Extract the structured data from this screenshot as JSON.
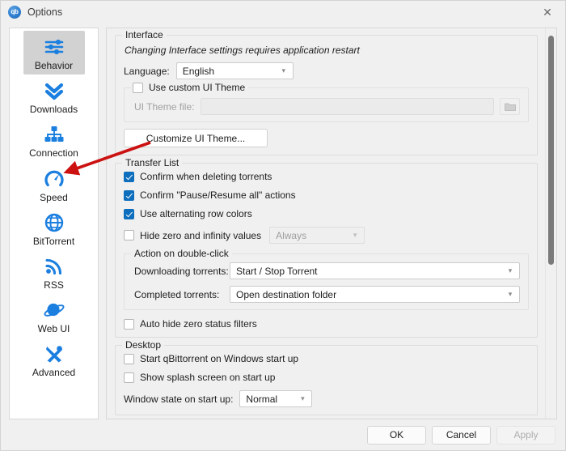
{
  "window": {
    "title": "Options",
    "logo_icon": "qbittorrent-logo",
    "close_icon": "✕"
  },
  "sidebar": {
    "items": [
      {
        "label": "Behavior",
        "icon": "sliders-icon",
        "selected": true
      },
      {
        "label": "Downloads",
        "icon": "download-icon",
        "selected": false
      },
      {
        "label": "Connection",
        "icon": "network-icon",
        "selected": false
      },
      {
        "label": "Speed",
        "icon": "speedometer-icon",
        "selected": false
      },
      {
        "label": "BitTorrent",
        "icon": "globe-icon",
        "selected": false
      },
      {
        "label": "RSS",
        "icon": "rss-icon",
        "selected": false
      },
      {
        "label": "Web UI",
        "icon": "planet-icon",
        "selected": false
      },
      {
        "label": "Advanced",
        "icon": "tools-icon",
        "selected": false
      }
    ]
  },
  "interface": {
    "group_title": "Interface",
    "restart_note": "Changing Interface settings requires application restart",
    "language_label": "Language:",
    "language_value": "English",
    "custom_theme_label": "Use custom UI Theme",
    "custom_theme_checked": false,
    "theme_file_label": "UI Theme file:",
    "theme_file_value": "",
    "theme_file_placeholder": "",
    "browse_icon": "folder-icon",
    "customize_button": "Customize UI Theme..."
  },
  "transfer_list": {
    "group_title": "Transfer List",
    "confirm_delete_label": "Confirm when deleting torrents",
    "confirm_delete_checked": true,
    "confirm_pause_label": "Confirm \"Pause/Resume all\" actions",
    "confirm_pause_checked": true,
    "alternating_label": "Use alternating row colors",
    "alternating_checked": true,
    "hide_zero_label": "Hide zero and infinity values",
    "hide_zero_checked": false,
    "hide_zero_value": "Always",
    "double_click": {
      "group_title": "Action on double-click",
      "downloading_label": "Downloading torrents:",
      "downloading_value": "Start / Stop Torrent",
      "completed_label": "Completed torrents:",
      "completed_value": "Open destination folder"
    },
    "auto_hide_label": "Auto hide zero status filters",
    "auto_hide_checked": false
  },
  "desktop": {
    "group_title": "Desktop",
    "start_on_windows_label": "Start qBittorrent on Windows start up",
    "start_on_windows_checked": false,
    "splash_label": "Show splash screen on start up",
    "splash_checked": false,
    "window_state_label": "Window state on start up:",
    "window_state_value": "Normal"
  },
  "footer": {
    "ok": "OK",
    "cancel": "Cancel",
    "apply": "Apply",
    "apply_disabled": true
  },
  "annotation": {
    "arrow_color": "#cc1111",
    "target": "speed-sidebar-item"
  }
}
